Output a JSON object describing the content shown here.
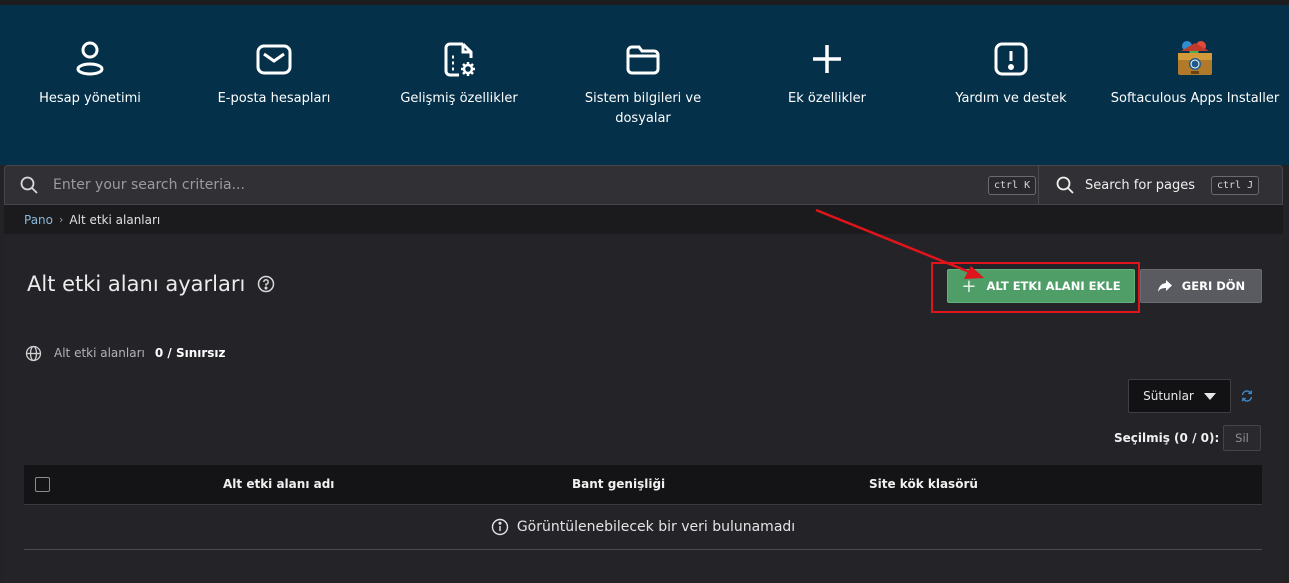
{
  "nav": {
    "items": [
      {
        "label": "Hesap yönetimi",
        "icon": "user-icon"
      },
      {
        "label": "E-posta hesapları",
        "icon": "mail-icon"
      },
      {
        "label": "Gelişmiş özellikler",
        "icon": "document-gear-icon"
      },
      {
        "label": "Sistem bilgileri ve dosyalar",
        "icon": "folder-icon"
      },
      {
        "label": "Ek özellikler",
        "icon": "plus-icon"
      },
      {
        "label": "Yardım ve destek",
        "icon": "alert-icon"
      },
      {
        "label": "Softaculous Apps Installer",
        "icon": "softaculous-icon"
      }
    ]
  },
  "search": {
    "placeholder": "Enter your search criteria...",
    "shortcut": "ctrl K",
    "pages_label": "Search for pages",
    "pages_shortcut": "ctrl J"
  },
  "breadcrumb": {
    "home": "Pano",
    "current": "Alt etki alanları"
  },
  "page": {
    "title": "Alt etki alanı ayarları",
    "add_button": "ALT ETKI ALANI EKLE",
    "back_button": "GERI DÖN"
  },
  "stats": {
    "label": "Alt etki alanları",
    "value": "0 / Sınırsız"
  },
  "toolbar": {
    "columns_label": "Sütunlar",
    "selected_label": "Seçilmiş (0 / 0):",
    "delete_label": "Sil"
  },
  "table": {
    "headers": [
      "Alt etki alanı adı",
      "Bant genişliği",
      "Site kök klasörü"
    ],
    "empty_message": "Görüntülenebilecek bir veri bulunamadı"
  },
  "colors": {
    "nav_bg": "#053049",
    "add_button": "#4f9e68",
    "back_button": "#595b60",
    "highlight": "#e0141b"
  }
}
